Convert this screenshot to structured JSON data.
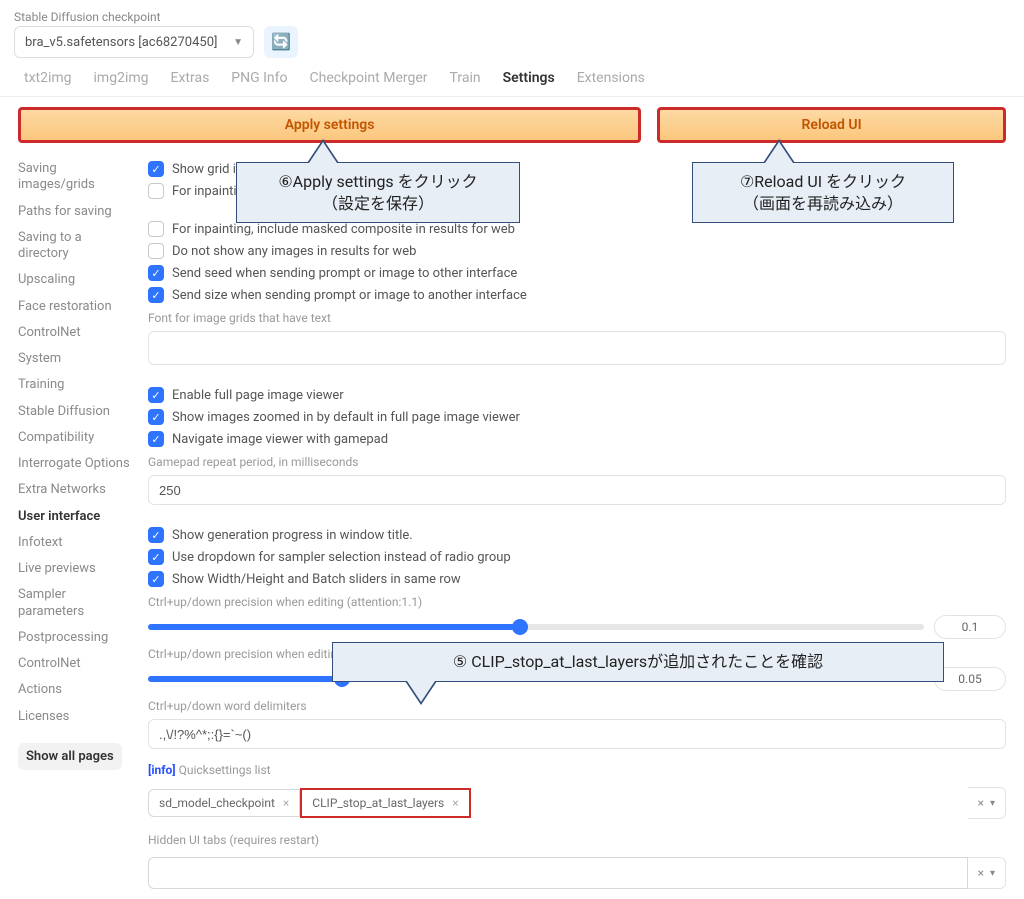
{
  "header": {
    "checkpoint_label": "Stable Diffusion checkpoint",
    "checkpoint_value": "bra_v5.safetensors [ac68270450]"
  },
  "tabs": [
    "txt2img",
    "img2img",
    "Extras",
    "PNG Info",
    "Checkpoint Merger",
    "Train",
    "Settings",
    "Extensions"
  ],
  "active_tab": "Settings",
  "buttons": {
    "apply": "Apply settings",
    "reload": "Reload UI"
  },
  "sidebar": {
    "items": [
      "Saving images/grids",
      "Paths for saving",
      "Saving to a directory",
      "Upscaling",
      "Face restoration",
      "ControlNet",
      "System",
      "Training",
      "Stable Diffusion",
      "Compatibility",
      "Interrogate Options",
      "Extra Networks",
      "User interface",
      "Infotext",
      "Live previews",
      "Sampler parameters",
      "Postprocessing",
      "ControlNet",
      "Actions",
      "Licenses"
    ],
    "active": "User interface",
    "show_all": "Show all pages"
  },
  "checks": {
    "show_grid": "Show grid in results",
    "inpaint_incl": "For inpainting, inclu",
    "inpaint_web": "For inpainting, include masked composite in results for web",
    "no_images_web": "Do not show any images in results for web",
    "send_seed": "Send seed when sending prompt or image to other interface",
    "send_size": "Send size when sending prompt or image to another interface",
    "font_hint": "Font for image grids that have text",
    "enable_viewer": "Enable full page image viewer",
    "zoom_default": "Show images zoomed in by default in full page image viewer",
    "gamepad": "Navigate image viewer with gamepad",
    "gamepad_hint": "Gamepad repeat period, in milliseconds",
    "gamepad_value": "250",
    "progress_title": "Show generation progress in window title.",
    "dropdown_sampler": "Use dropdown for sampler selection instead of radio group",
    "wh_sliders": "Show Width/Height and Batch sliders in same row",
    "slider1_label": "Ctrl+up/down precision when editing (attention:1.1)",
    "slider1_val": "0.1",
    "slider2_label": "Ctrl+up/down precision when editing <extra networks:0.9>",
    "slider2_val": "0.05",
    "delim_label": "Ctrl+up/down word delimiters",
    "delim_value": ".,\\/!?%^*;:{}=`~()",
    "quick_prefix": "[info]",
    "quick_label": " Quicksettings list",
    "chips": [
      "sd_model_checkpoint",
      "CLIP_stop_at_last_layers"
    ],
    "hidden_label": "Hidden UI tabs (requires restart)"
  },
  "callouts": {
    "apply": "⑥Apply settings をクリック\n（設定を保存）",
    "reload": "⑦Reload UI をクリック\n（画面を再読み込み）",
    "clip": "⑤ CLIP_stop_at_last_layersが追加されたことを確認"
  }
}
